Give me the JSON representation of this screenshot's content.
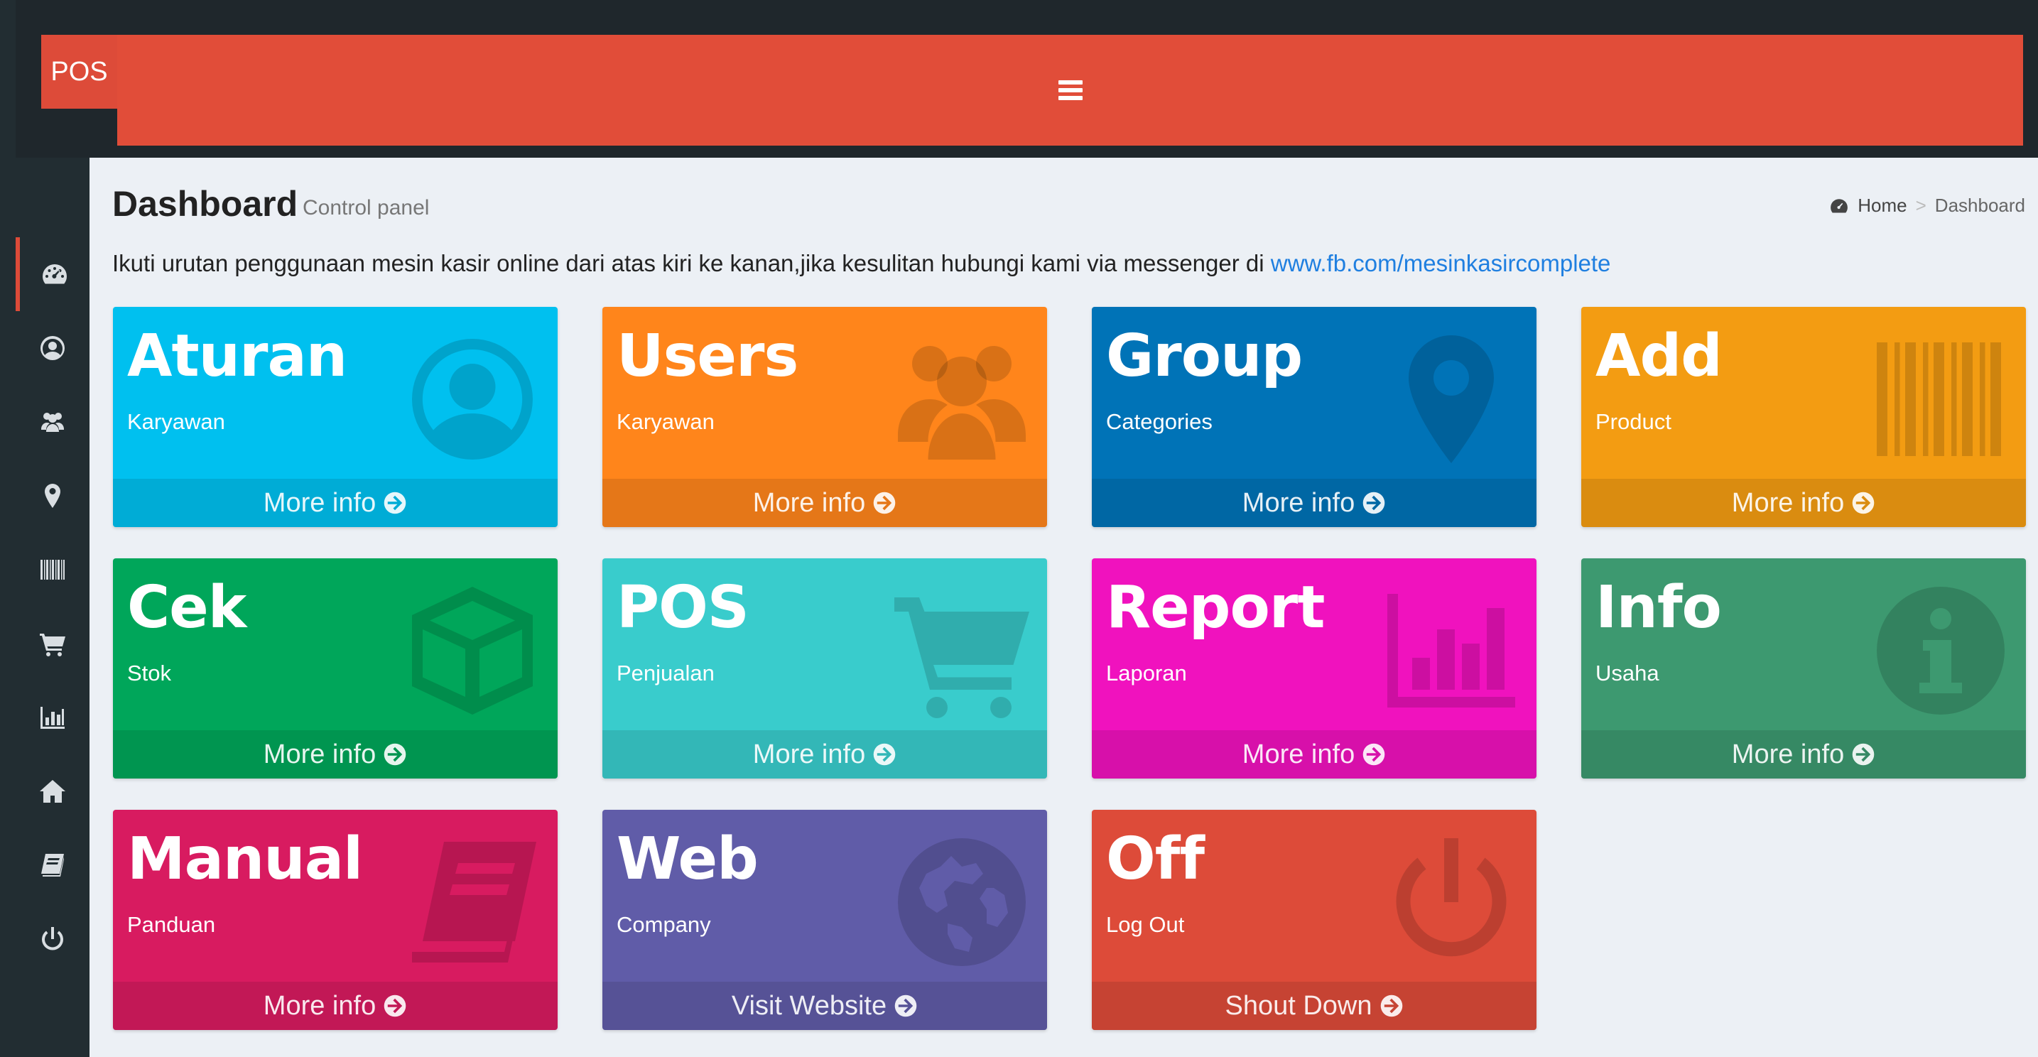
{
  "header": {
    "logo": "POS"
  },
  "page": {
    "title": "Dashboard",
    "subtitle": "Control panel",
    "breadcrumb": {
      "home": "Home",
      "separator": ">",
      "current": "Dashboard"
    },
    "intro_text": "Ikuti urutan penggunaan mesin kasir online dari atas kiri ke kanan,jika kesulitan hubungi kami via messenger di ",
    "intro_link": "www.fb.com/mesinkasircomplete"
  },
  "sidebar": {
    "items": [
      {
        "icon": "dashboard-icon"
      },
      {
        "icon": "user-circle-icon"
      },
      {
        "icon": "users-icon"
      },
      {
        "icon": "map-marker-icon"
      },
      {
        "icon": "barcode-icon"
      },
      {
        "icon": "cart-icon"
      },
      {
        "icon": "bar-chart-icon"
      },
      {
        "icon": "home-icon"
      },
      {
        "icon": "book-icon"
      },
      {
        "icon": "power-icon"
      }
    ]
  },
  "boxes": [
    {
      "title": "Aturan",
      "subtitle": "Karyawan",
      "link": "More info",
      "color": "#00c0ef",
      "icon": "user-circle-icon"
    },
    {
      "title": "Users",
      "subtitle": "Karyawan",
      "link": "More info",
      "color": "#ff851b",
      "icon": "users-icon"
    },
    {
      "title": "Group",
      "subtitle": "Categories",
      "link": "More info",
      "color": "#0073b7",
      "icon": "map-marker-icon"
    },
    {
      "title": "Add",
      "subtitle": "Product",
      "link": "More info",
      "color": "#f39c12",
      "icon": "barcode-icon"
    },
    {
      "title": "Cek",
      "subtitle": "Stok",
      "link": "More info",
      "color": "#00a65a",
      "icon": "cube-icon"
    },
    {
      "title": "POS",
      "subtitle": "Penjualan",
      "link": "More info",
      "color": "#39cccc",
      "icon": "cart-icon"
    },
    {
      "title": "Report",
      "subtitle": "Laporan",
      "link": "More info",
      "color": "#f012be",
      "icon": "bar-chart-icon"
    },
    {
      "title": "Info",
      "subtitle": "Usaha",
      "link": "More info",
      "color": "#3d9970",
      "icon": "info-icon"
    },
    {
      "title": "Manual",
      "subtitle": "Panduan",
      "link": "More info",
      "color": "#d81b60",
      "icon": "book-icon"
    },
    {
      "title": "Web",
      "subtitle": "Company",
      "link": "Visit Website",
      "color": "#605ca8",
      "icon": "globe-icon"
    },
    {
      "title": "Off",
      "subtitle": "Log Out",
      "link": "Shout Down",
      "color": "#dd4b39",
      "icon": "power-icon"
    }
  ]
}
